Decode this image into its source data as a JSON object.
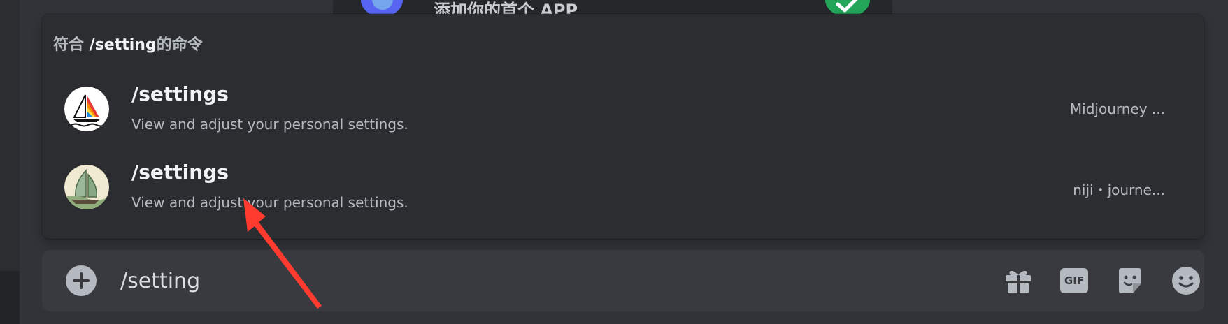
{
  "background": {
    "partial_text": "添加你的首个 APP"
  },
  "popup": {
    "header_prefix": "符合 ",
    "header_query": "/setting",
    "header_suffix": "的命令",
    "commands": [
      {
        "name": "/settings",
        "description": "View and adjust your personal settings.",
        "app": "Midjourney ...",
        "avatar_icon": "sailboat-icon"
      },
      {
        "name": "/settings",
        "description": "View and adjust your personal settings.",
        "app": "niji・journe...",
        "avatar_icon": "junk-boat-icon"
      }
    ]
  },
  "chatbar": {
    "input_value": "/setting",
    "icons": [
      "plus-circle-icon",
      "gift-icon",
      "gif-icon",
      "sticker-icon",
      "emoji-icon"
    ],
    "gif_label": "GIF"
  },
  "annotation": {
    "arrow_color": "#ff3b30"
  },
  "colors": {
    "popup_bg": "#2b2d31",
    "chatbar_bg": "#383a40",
    "accent_green": "#23a55a"
  }
}
